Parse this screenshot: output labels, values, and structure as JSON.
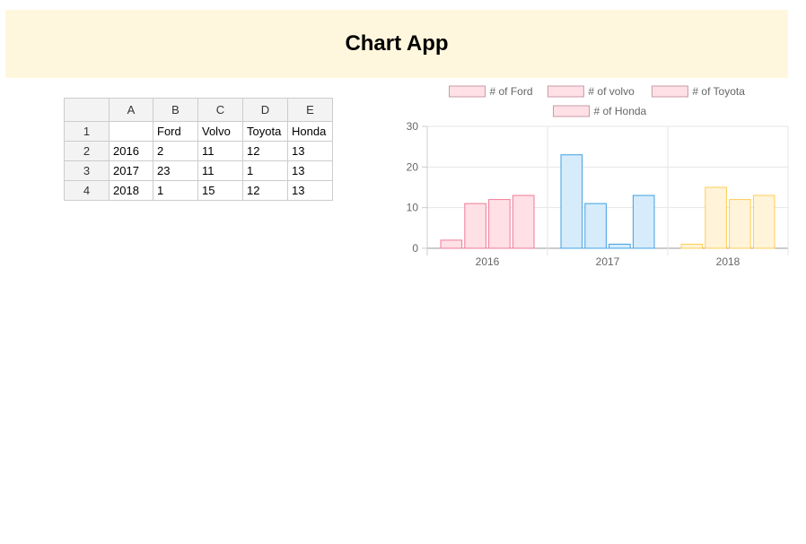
{
  "app": {
    "title": "Chart App"
  },
  "sheet": {
    "columns": [
      "",
      "A",
      "B",
      "C",
      "D",
      "E"
    ],
    "rows": [
      {
        "row_label": "1",
        "cells": [
          "",
          "Ford",
          "Volvo",
          "Toyota",
          "Honda"
        ]
      },
      {
        "row_label": "2",
        "cells": [
          "2016",
          "2",
          "11",
          "12",
          "13"
        ]
      },
      {
        "row_label": "3",
        "cells": [
          "2017",
          "23",
          "11",
          "1",
          "13"
        ]
      },
      {
        "row_label": "4",
        "cells": [
          "2018",
          "1",
          "15",
          "12",
          "13"
        ]
      }
    ]
  },
  "chart_data": {
    "type": "bar",
    "categories": [
      "2016",
      "2017",
      "2018"
    ],
    "series": [
      {
        "name": "# of Ford",
        "values": [
          2,
          23,
          1
        ]
      },
      {
        "name": "# of volvo",
        "values": [
          11,
          11,
          15
        ]
      },
      {
        "name": "# of Toyota",
        "values": [
          12,
          1,
          12
        ]
      },
      {
        "name": "# of Honda",
        "values": [
          13,
          13,
          13
        ]
      }
    ],
    "ylim": [
      0,
      30
    ],
    "yticks": [
      0,
      10,
      20,
      30
    ],
    "grid": true,
    "legend_position": "top",
    "category_colors": [
      {
        "fill": "#ffe0e6",
        "stroke": "#f27a96"
      },
      {
        "fill": "#d7ecfb",
        "stroke": "#3ea0e4"
      },
      {
        "fill": "#fff4d9",
        "stroke": "#ffcd56"
      }
    ],
    "legend_swatch": {
      "fill": "#ffe0e6",
      "stroke": "#c99aa6"
    },
    "title": "",
    "xlabel": "",
    "ylabel": ""
  }
}
